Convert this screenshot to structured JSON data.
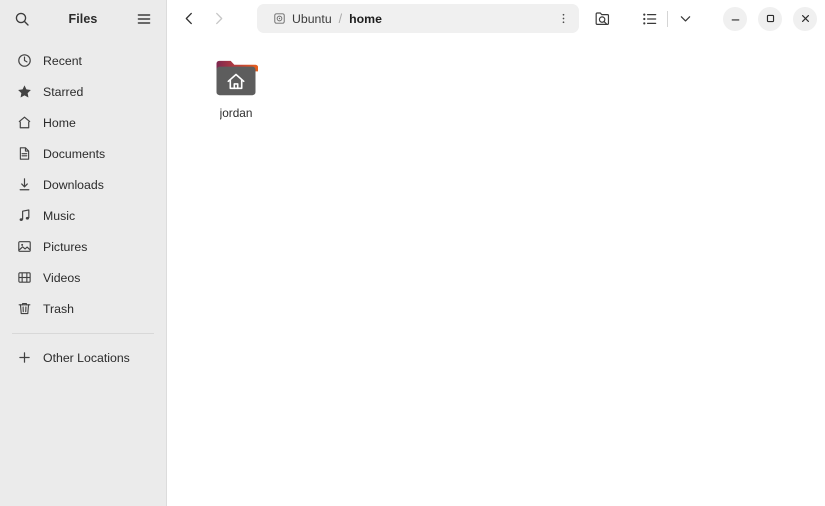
{
  "sidebar": {
    "title": "Files",
    "search_icon": "search-icon",
    "menu_icon": "hamburger-menu-icon",
    "items": [
      {
        "label": "Recent",
        "icon": "clock-icon",
        "name": "recent"
      },
      {
        "label": "Starred",
        "icon": "star-icon",
        "name": "starred"
      },
      {
        "label": "Home",
        "icon": "home-icon",
        "name": "home"
      },
      {
        "label": "Documents",
        "icon": "document-icon",
        "name": "documents"
      },
      {
        "label": "Downloads",
        "icon": "download-icon",
        "name": "downloads"
      },
      {
        "label": "Music",
        "icon": "music-note-icon",
        "name": "music"
      },
      {
        "label": "Pictures",
        "icon": "image-icon",
        "name": "pictures"
      },
      {
        "label": "Videos",
        "icon": "video-icon",
        "name": "videos"
      },
      {
        "label": "Trash",
        "icon": "trash-icon",
        "name": "trash"
      }
    ],
    "other_locations": {
      "label": "Other Locations",
      "icon": "plus-icon"
    }
  },
  "toolbar": {
    "back_icon": "chevron-left-icon",
    "forward_icon": "chevron-right-icon",
    "search_folder_icon": "search-folder-icon",
    "view_list_icon": "list-view-icon",
    "view_dropdown_icon": "chevron-down-icon",
    "minimize_label": "–",
    "maximize_label": "□",
    "close_label": "×",
    "minimize_name": "minimize-button",
    "maximize_name": "maximize-button",
    "close_name": "close-button"
  },
  "pathbar": {
    "drive_icon": "drive-icon",
    "crumbs": [
      {
        "label": "Ubuntu",
        "current": false
      },
      {
        "label": "home",
        "current": true
      }
    ],
    "separator": "/",
    "menu_icon": "three-dots-vertical-icon"
  },
  "files": [
    {
      "label": "jordan",
      "type": "home-folder",
      "icon": "home-folder-icon"
    }
  ],
  "colors": {
    "sidebar_bg": "#ebebeb",
    "main_bg": "#ffffff",
    "pathbar_bg": "#f0f0f0",
    "folder_body": "#5d5d5d",
    "folder_tab_start": "#8e2d52",
    "folder_tab_end": "#e8601c",
    "text_primary": "#2b2b2b"
  }
}
